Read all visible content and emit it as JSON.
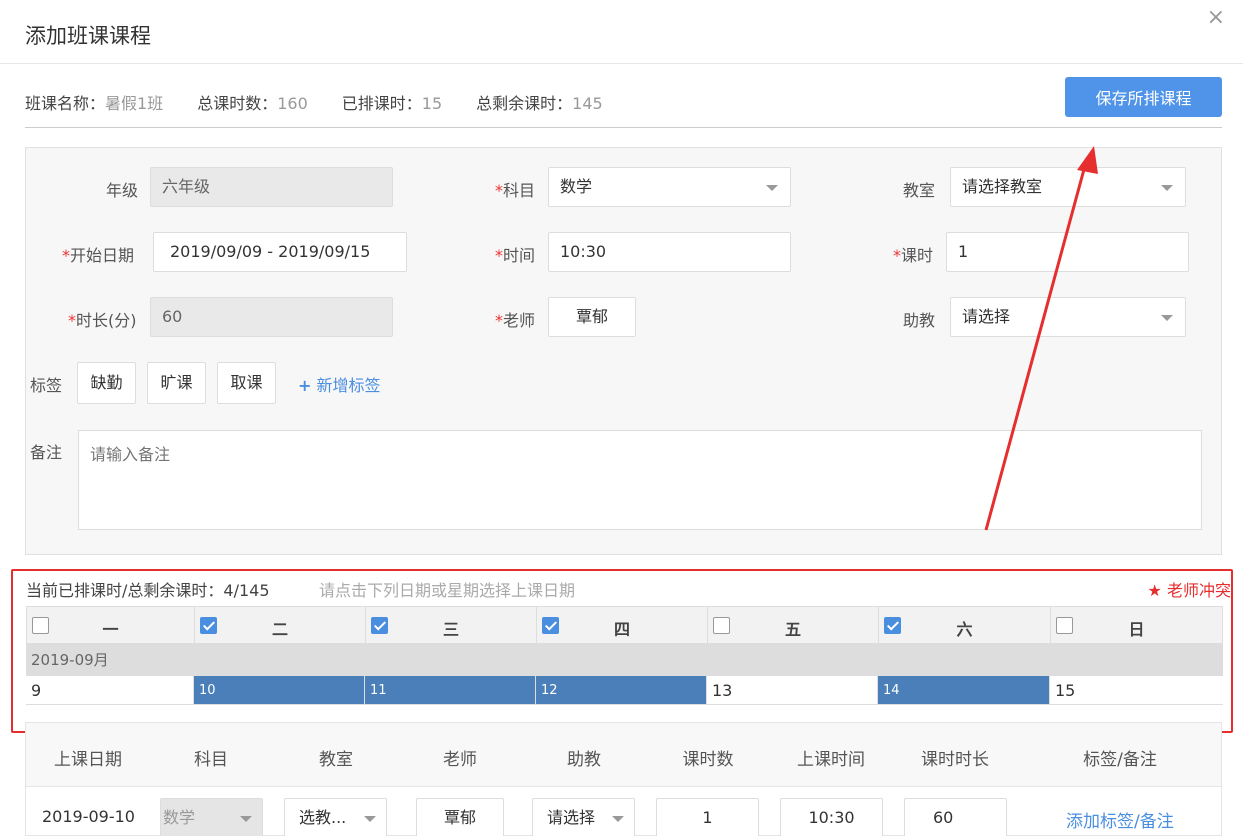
{
  "dialog": {
    "title": "添加班课课程",
    "close_icon": "×"
  },
  "info": {
    "class_name_label": "班课名称：",
    "class_name": "暑假1班",
    "total_label": "总课时数：",
    "total": "160",
    "scheduled_label": "已排课时：",
    "scheduled": "15",
    "remaining_label": "总剩余课时：",
    "remaining": "145",
    "save_label": "保存所排课程"
  },
  "form": {
    "grade_label": "年级",
    "grade": "六年级",
    "subject_label": "科目",
    "subject": "数学",
    "room_label": "教室",
    "room_placeholder": "请选择教室",
    "start_date_label": "开始日期",
    "start_date": "2019/09/09 - 2019/09/15",
    "time_label": "时间",
    "time": "10:30",
    "hours_label": "课时",
    "hours": "1",
    "duration_label": "时长(分)",
    "duration": "60",
    "teacher_label": "老师",
    "teacher": "覃郁",
    "assistant_label": "助教",
    "assistant_placeholder": "请选择",
    "tags_label": "标签",
    "tags": [
      "缺勤",
      "旷课",
      "取课"
    ],
    "add_tag": "新增标签",
    "memo_label": "备注",
    "memo_placeholder": "请输入备注",
    "required_mark": "*"
  },
  "schedule": {
    "summary": "当前已排课时/总剩余课时：4/145",
    "hint": "请点击下列日期或星期选择上课日期",
    "conflict": "老师冲突",
    "weekdays": [
      {
        "label": "一",
        "checked": false
      },
      {
        "label": "二",
        "checked": true
      },
      {
        "label": "三",
        "checked": true
      },
      {
        "label": "四",
        "checked": true
      },
      {
        "label": "五",
        "checked": false
      },
      {
        "label": "六",
        "checked": true
      },
      {
        "label": "日",
        "checked": false
      }
    ],
    "month": "2019-09月",
    "days": [
      {
        "day": "9",
        "selected": false
      },
      {
        "day": "10",
        "selected": true
      },
      {
        "day": "11",
        "selected": true
      },
      {
        "day": "12",
        "selected": true
      },
      {
        "day": "13",
        "selected": false
      },
      {
        "day": "14",
        "selected": true
      },
      {
        "day": "15",
        "selected": false
      }
    ]
  },
  "table": {
    "headers": [
      "上课日期",
      "科目",
      "教室",
      "老师",
      "助教",
      "课时数",
      "上课时间",
      "课时时长",
      "标签/备注"
    ],
    "row": {
      "date": "2019-09-10",
      "subject": "数学",
      "room": "选教...",
      "teacher": "覃郁",
      "assistant": "请选择",
      "hours": "1",
      "time": "10:30",
      "duration": "60",
      "action": "添加标签/备注"
    }
  },
  "colors": {
    "primary": "#4f94e8",
    "selected_day": "#4a7fb9",
    "alert": "#e62e2e"
  }
}
